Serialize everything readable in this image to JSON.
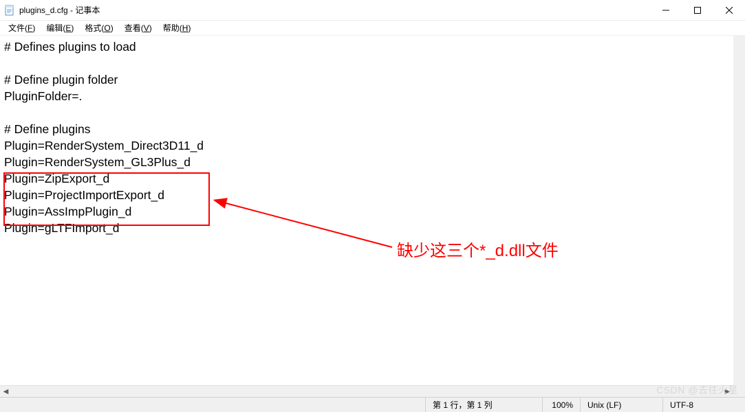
{
  "titlebar": {
    "title": "plugins_d.cfg - 记事本"
  },
  "menubar": {
    "file": "文件",
    "file_key": "F",
    "edit": "编辑",
    "edit_key": "E",
    "format": "格式",
    "format_key": "O",
    "view": "查看",
    "view_key": "V",
    "help": "帮助",
    "help_key": "H"
  },
  "content": {
    "lines": [
      "# Defines plugins to load",
      "",
      "# Define plugin folder",
      "PluginFolder=.",
      "",
      "# Define plugins",
      "Plugin=RenderSystem_Direct3D11_d",
      "Plugin=RenderSystem_GL3Plus_d",
      "Plugin=ZipExport_d",
      "Plugin=ProjectImportExport_d",
      "Plugin=AssImpPlugin_d",
      "Plugin=gLTFImport_d"
    ]
  },
  "annotation": {
    "text": "缺少这三个*_d.dll文件",
    "color": "#ff0000"
  },
  "statusbar": {
    "position": "第 1 行，第 1 列",
    "zoom": "100%",
    "lineending": "Unix (LF)",
    "encoding": "UTF-8"
  },
  "watermark": "CSDN @去往火星"
}
